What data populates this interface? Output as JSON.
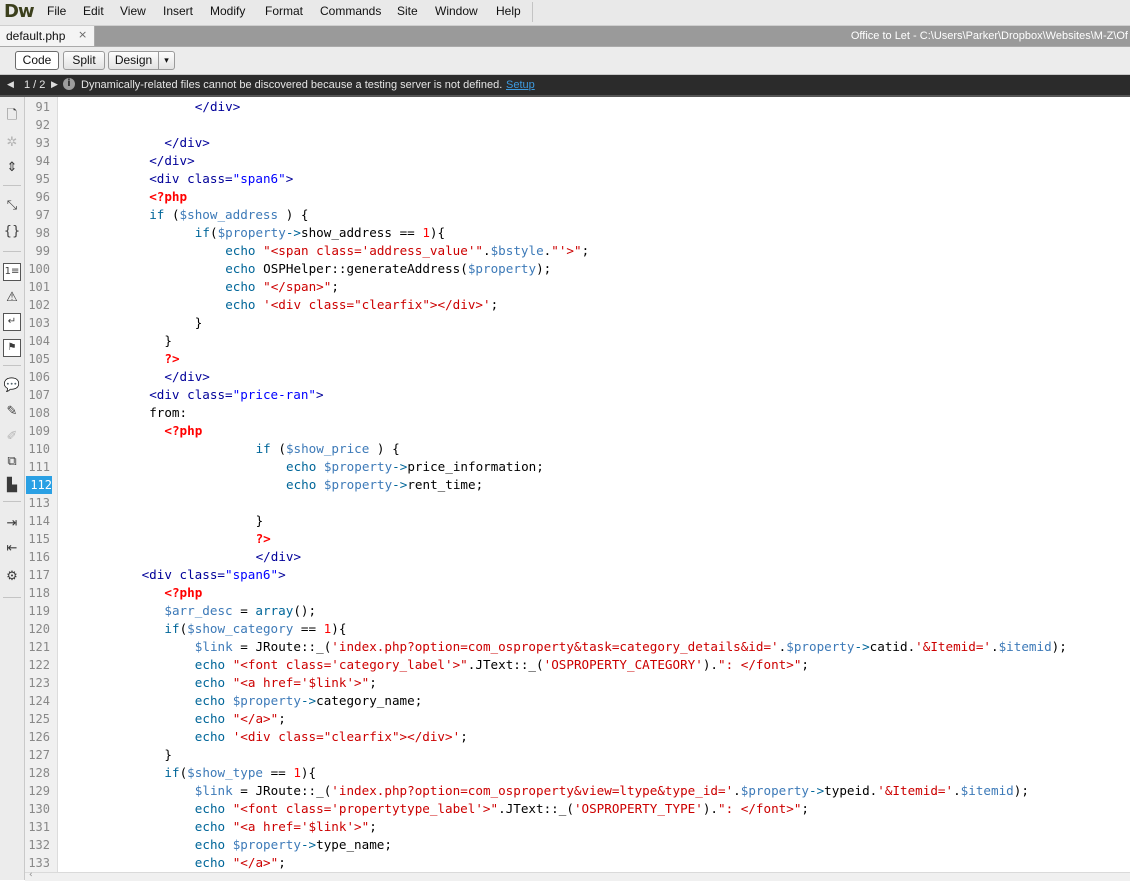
{
  "app": {
    "logo": "Dw"
  },
  "menu": [
    "File",
    "Edit",
    "View",
    "Insert",
    "Modify",
    "Format",
    "Commands",
    "Site",
    "Window",
    "Help"
  ],
  "tab": {
    "filename": "default.php",
    "close": "×",
    "path": "Office to Let - C:\\Users\\Parker\\Dropbox\\Websites\\M-Z\\Of"
  },
  "view_toolbar": {
    "code": "Code",
    "split": "Split",
    "design": "Design",
    "design_dropdown": "▾"
  },
  "infobar": {
    "prev": "◀",
    "next": "▶",
    "counter": "1 / 2",
    "icon": "i",
    "message": "Dynamically-related files cannot be discovered because a testing server is not defined.",
    "link": "Setup"
  },
  "left_tools": [
    {
      "icon": "open-documents-icon",
      "glyph": "🗋"
    },
    {
      "icon": "collapse-tag-icon",
      "glyph": "✲"
    },
    {
      "icon": "expand-all-icon",
      "glyph": "⇕"
    },
    {
      "icon": "select-parent-tag-icon",
      "glyph": "⤡"
    },
    {
      "icon": "balance-braces-icon",
      "glyph": "{}"
    },
    {
      "icon": "line-numbers-icon",
      "glyph": "1≡"
    },
    {
      "icon": "highlight-invalid-code-icon",
      "glyph": "⚠"
    },
    {
      "icon": "word-wrap-icon",
      "glyph": "↵"
    },
    {
      "icon": "syntax-error-alerts-icon",
      "glyph": "⚑"
    },
    {
      "icon": "apply-comment-icon",
      "glyph": "💬"
    },
    {
      "icon": "remove-comment-icon",
      "glyph": "✎"
    },
    {
      "icon": "wrap-tag-icon",
      "glyph": "✐"
    },
    {
      "icon": "recent-snippets-icon",
      "glyph": "⧉"
    },
    {
      "icon": "move-css-icon",
      "glyph": "▙"
    },
    {
      "icon": "indent-code-icon",
      "glyph": "⇥"
    },
    {
      "icon": "outdent-code-icon",
      "glyph": "⇤"
    },
    {
      "icon": "format-source-icon",
      "glyph": "⚙"
    }
  ],
  "editor": {
    "active_line": 112,
    "lines": [
      {
        "n": 91,
        "indent": 18,
        "tokens": [
          [
            "tag",
            "</div>"
          ]
        ]
      },
      {
        "n": 92,
        "indent": 0,
        "tokens": []
      },
      {
        "n": 93,
        "indent": 14,
        "tokens": [
          [
            "tag",
            "</div>"
          ]
        ]
      },
      {
        "n": 94,
        "indent": 12,
        "tokens": [
          [
            "tag",
            "</div>"
          ]
        ]
      },
      {
        "n": 95,
        "indent": 12,
        "tokens": [
          [
            "tag",
            "<div "
          ],
          [
            "attr",
            "class="
          ],
          [
            "str",
            "\"span6\""
          ],
          [
            "tag",
            ">"
          ]
        ]
      },
      {
        "n": 96,
        "indent": 12,
        "tokens": [
          [
            "php",
            "<?php"
          ]
        ]
      },
      {
        "n": 97,
        "indent": 12,
        "tokens": [
          [
            "kw",
            "if "
          ],
          [
            "punc",
            "("
          ],
          [
            "var",
            "$show_address"
          ],
          [
            "punc",
            " ) {"
          ]
        ]
      },
      {
        "n": 98,
        "indent": 18,
        "tokens": [
          [
            "kw",
            "if"
          ],
          [
            "punc",
            "("
          ],
          [
            "var",
            "$property"
          ],
          [
            "kw",
            "->"
          ],
          [
            "plain",
            "show_address "
          ],
          [
            "punc",
            "== "
          ],
          [
            "num",
            "1"
          ],
          [
            "punc",
            "){"
          ]
        ]
      },
      {
        "n": 99,
        "indent": 22,
        "tokens": [
          [
            "kw",
            "echo "
          ],
          [
            "pstr",
            "\"<span class='address_value'\""
          ],
          [
            "punc",
            "."
          ],
          [
            "var",
            "$bstyle"
          ],
          [
            "punc",
            "."
          ],
          [
            "pstr",
            "\"'>\""
          ],
          [
            "punc",
            ";"
          ]
        ]
      },
      {
        "n": 100,
        "indent": 22,
        "tokens": [
          [
            "kw",
            "echo "
          ],
          [
            "plain",
            "OSPHelper::generateAddress("
          ],
          [
            "var",
            "$property"
          ],
          [
            "punc",
            ");"
          ]
        ]
      },
      {
        "n": 101,
        "indent": 22,
        "tokens": [
          [
            "kw",
            "echo "
          ],
          [
            "pstr",
            "\"</span>\""
          ],
          [
            "punc",
            ";"
          ]
        ]
      },
      {
        "n": 102,
        "indent": 22,
        "tokens": [
          [
            "kw",
            "echo "
          ],
          [
            "pstr",
            "'<div class=\"clearfix\"></div>'"
          ],
          [
            "punc",
            ";"
          ]
        ]
      },
      {
        "n": 103,
        "indent": 18,
        "tokens": [
          [
            "punc",
            "}"
          ]
        ]
      },
      {
        "n": 104,
        "indent": 14,
        "tokens": [
          [
            "punc",
            "}"
          ]
        ]
      },
      {
        "n": 105,
        "indent": 14,
        "tokens": [
          [
            "php",
            "?>"
          ]
        ]
      },
      {
        "n": 106,
        "indent": 14,
        "tokens": [
          [
            "tag",
            "</div>"
          ]
        ]
      },
      {
        "n": 107,
        "indent": 12,
        "tokens": [
          [
            "tag",
            "<div "
          ],
          [
            "attr",
            "class="
          ],
          [
            "str",
            "\"price-ran\""
          ],
          [
            "tag",
            ">"
          ]
        ]
      },
      {
        "n": 108,
        "indent": 12,
        "tokens": [
          [
            "plain",
            "from:"
          ]
        ]
      },
      {
        "n": 109,
        "indent": 14,
        "tokens": [
          [
            "php",
            "<?php"
          ]
        ]
      },
      {
        "n": 110,
        "indent": 26,
        "tokens": [
          [
            "kw",
            "if "
          ],
          [
            "punc",
            "("
          ],
          [
            "var",
            "$show_price"
          ],
          [
            "punc",
            " ) {"
          ]
        ]
      },
      {
        "n": 111,
        "indent": 30,
        "tokens": [
          [
            "kw",
            "echo "
          ],
          [
            "var",
            "$property"
          ],
          [
            "kw",
            "->"
          ],
          [
            "plain",
            "price_information;"
          ]
        ]
      },
      {
        "n": 112,
        "indent": 30,
        "tokens": [
          [
            "kw",
            "echo "
          ],
          [
            "var",
            "$property"
          ],
          [
            "kw",
            "->"
          ],
          [
            "plain",
            "rent_time;"
          ]
        ]
      },
      {
        "n": 113,
        "indent": 0,
        "tokens": []
      },
      {
        "n": 114,
        "indent": 26,
        "tokens": [
          [
            "punc",
            "}"
          ]
        ]
      },
      {
        "n": 115,
        "indent": 26,
        "tokens": [
          [
            "php",
            "?>"
          ]
        ]
      },
      {
        "n": 116,
        "indent": 26,
        "tokens": [
          [
            "tag",
            "</div>"
          ]
        ]
      },
      {
        "n": 117,
        "indent": 11,
        "tokens": [
          [
            "tag",
            "<div "
          ],
          [
            "attr",
            "class="
          ],
          [
            "str",
            "\"span6\""
          ],
          [
            "tag",
            ">"
          ]
        ]
      },
      {
        "n": 118,
        "indent": 14,
        "tokens": [
          [
            "php",
            "<?php"
          ]
        ]
      },
      {
        "n": 119,
        "indent": 14,
        "tokens": [
          [
            "var",
            "$arr_desc"
          ],
          [
            "punc",
            " = "
          ],
          [
            "kw",
            "array"
          ],
          [
            "punc",
            "();"
          ]
        ]
      },
      {
        "n": 120,
        "indent": 14,
        "tokens": [
          [
            "kw",
            "if"
          ],
          [
            "punc",
            "("
          ],
          [
            "var",
            "$show_category"
          ],
          [
            "punc",
            " == "
          ],
          [
            "num",
            "1"
          ],
          [
            "punc",
            "){"
          ]
        ]
      },
      {
        "n": 121,
        "indent": 18,
        "tokens": [
          [
            "var",
            "$link"
          ],
          [
            "punc",
            " = "
          ],
          [
            "plain",
            "JRoute::_("
          ],
          [
            "pstr",
            "'index.php?option=com_osproperty&task=category_details&id='"
          ],
          [
            "punc",
            "."
          ],
          [
            "var",
            "$property"
          ],
          [
            "kw",
            "->"
          ],
          [
            "plain",
            "catid."
          ],
          [
            "pstr",
            "'&Itemid='"
          ],
          [
            "punc",
            "."
          ],
          [
            "var",
            "$itemid"
          ],
          [
            "punc",
            ");"
          ]
        ]
      },
      {
        "n": 122,
        "indent": 18,
        "tokens": [
          [
            "kw",
            "echo "
          ],
          [
            "pstr",
            "\"<font class='category_label'>\""
          ],
          [
            "punc",
            "."
          ],
          [
            "plain",
            "JText::_("
          ],
          [
            "pstr",
            "'OSPROPERTY_CATEGORY'"
          ],
          [
            "punc",
            ")."
          ],
          [
            "pstr",
            "\": </font>\""
          ],
          [
            "punc",
            ";"
          ]
        ]
      },
      {
        "n": 123,
        "indent": 18,
        "tokens": [
          [
            "kw",
            "echo "
          ],
          [
            "pstr",
            "\"<a href='$link'>\""
          ],
          [
            "punc",
            ";"
          ]
        ]
      },
      {
        "n": 124,
        "indent": 18,
        "tokens": [
          [
            "kw",
            "echo "
          ],
          [
            "var",
            "$property"
          ],
          [
            "kw",
            "->"
          ],
          [
            "plain",
            "category_name;"
          ]
        ]
      },
      {
        "n": 125,
        "indent": 18,
        "tokens": [
          [
            "kw",
            "echo "
          ],
          [
            "pstr",
            "\"</a>\""
          ],
          [
            "punc",
            ";"
          ]
        ]
      },
      {
        "n": 126,
        "indent": 18,
        "tokens": [
          [
            "kw",
            "echo "
          ],
          [
            "pstr",
            "'<div class=\"clearfix\"></div>'"
          ],
          [
            "punc",
            ";"
          ]
        ]
      },
      {
        "n": 127,
        "indent": 14,
        "tokens": [
          [
            "punc",
            "}"
          ]
        ]
      },
      {
        "n": 128,
        "indent": 14,
        "tokens": [
          [
            "kw",
            "if"
          ],
          [
            "punc",
            "("
          ],
          [
            "var",
            "$show_type"
          ],
          [
            "punc",
            " == "
          ],
          [
            "num",
            "1"
          ],
          [
            "punc",
            "){"
          ]
        ]
      },
      {
        "n": 129,
        "indent": 18,
        "tokens": [
          [
            "var",
            "$link"
          ],
          [
            "punc",
            " = "
          ],
          [
            "plain",
            "JRoute::_("
          ],
          [
            "pstr",
            "'index.php?option=com_osproperty&view=ltype&type_id='"
          ],
          [
            "punc",
            "."
          ],
          [
            "var",
            "$property"
          ],
          [
            "kw",
            "->"
          ],
          [
            "plain",
            "typeid."
          ],
          [
            "pstr",
            "'&Itemid='"
          ],
          [
            "punc",
            "."
          ],
          [
            "var",
            "$itemid"
          ],
          [
            "punc",
            ");"
          ]
        ]
      },
      {
        "n": 130,
        "indent": 18,
        "tokens": [
          [
            "kw",
            "echo "
          ],
          [
            "pstr",
            "\"<font class='propertytype_label'>\""
          ],
          [
            "punc",
            "."
          ],
          [
            "plain",
            "JText::_("
          ],
          [
            "pstr",
            "'OSPROPERTY_TYPE'"
          ],
          [
            "punc",
            ")."
          ],
          [
            "pstr",
            "\": </font>\""
          ],
          [
            "punc",
            ";"
          ]
        ]
      },
      {
        "n": 131,
        "indent": 18,
        "tokens": [
          [
            "kw",
            "echo "
          ],
          [
            "pstr",
            "\"<a href='$link'>\""
          ],
          [
            "punc",
            ";"
          ]
        ]
      },
      {
        "n": 132,
        "indent": 18,
        "tokens": [
          [
            "kw",
            "echo "
          ],
          [
            "var",
            "$property"
          ],
          [
            "kw",
            "->"
          ],
          [
            "plain",
            "type_name;"
          ]
        ]
      },
      {
        "n": 133,
        "indent": 18,
        "tokens": [
          [
            "kw",
            "echo "
          ],
          [
            "pstr",
            "\"</a>\""
          ],
          [
            "punc",
            ";"
          ]
        ]
      }
    ]
  }
}
